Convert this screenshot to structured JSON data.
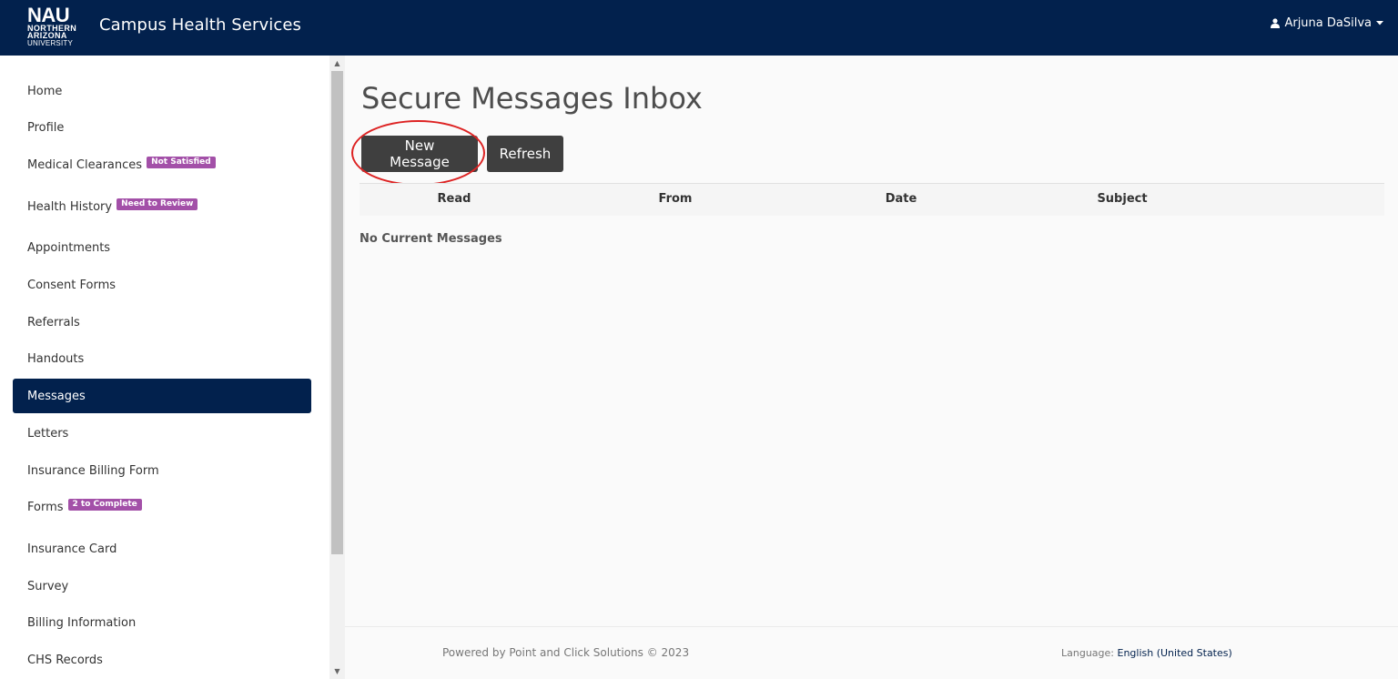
{
  "header": {
    "logo": {
      "main": "NAU",
      "line1": "NORTHERN",
      "line2": "ARIZONA",
      "line3": "UNIVERSITY"
    },
    "app_title": "Campus Health Services",
    "user_name": "Arjuna DaSilva",
    "bg_color": "#02214d"
  },
  "sidebar": {
    "items": [
      {
        "label": "Home"
      },
      {
        "label": "Profile"
      },
      {
        "label": "Medical Clearances",
        "badge": "Not Satisfied"
      },
      {
        "label": "Health History",
        "badge": "Need to Review"
      },
      {
        "label": "Appointments"
      },
      {
        "label": "Consent Forms"
      },
      {
        "label": "Referrals"
      },
      {
        "label": "Handouts"
      },
      {
        "label": "Messages",
        "active": true
      },
      {
        "label": "Letters"
      },
      {
        "label": "Insurance Billing Form"
      },
      {
        "label": "Forms",
        "badge": "2 to Complete"
      },
      {
        "label": "Insurance Card"
      },
      {
        "label": "Survey"
      },
      {
        "label": "Billing Information"
      },
      {
        "label": "CHS Records"
      }
    ],
    "badge_color": "#a350a8"
  },
  "main": {
    "title": "Secure Messages Inbox",
    "buttons": {
      "new_message": "New Message",
      "refresh": "Refresh"
    },
    "table": {
      "columns": [
        "Read",
        "From",
        "Date",
        "Subject"
      ],
      "empty_text": "No Current Messages"
    }
  },
  "footer": {
    "powered_by": "Powered by Point and Click Solutions © 2023",
    "language_label": "Language:",
    "language_value": "English (United States)"
  },
  "icons": {
    "user": "user-icon",
    "caret": "caret-down-icon"
  }
}
